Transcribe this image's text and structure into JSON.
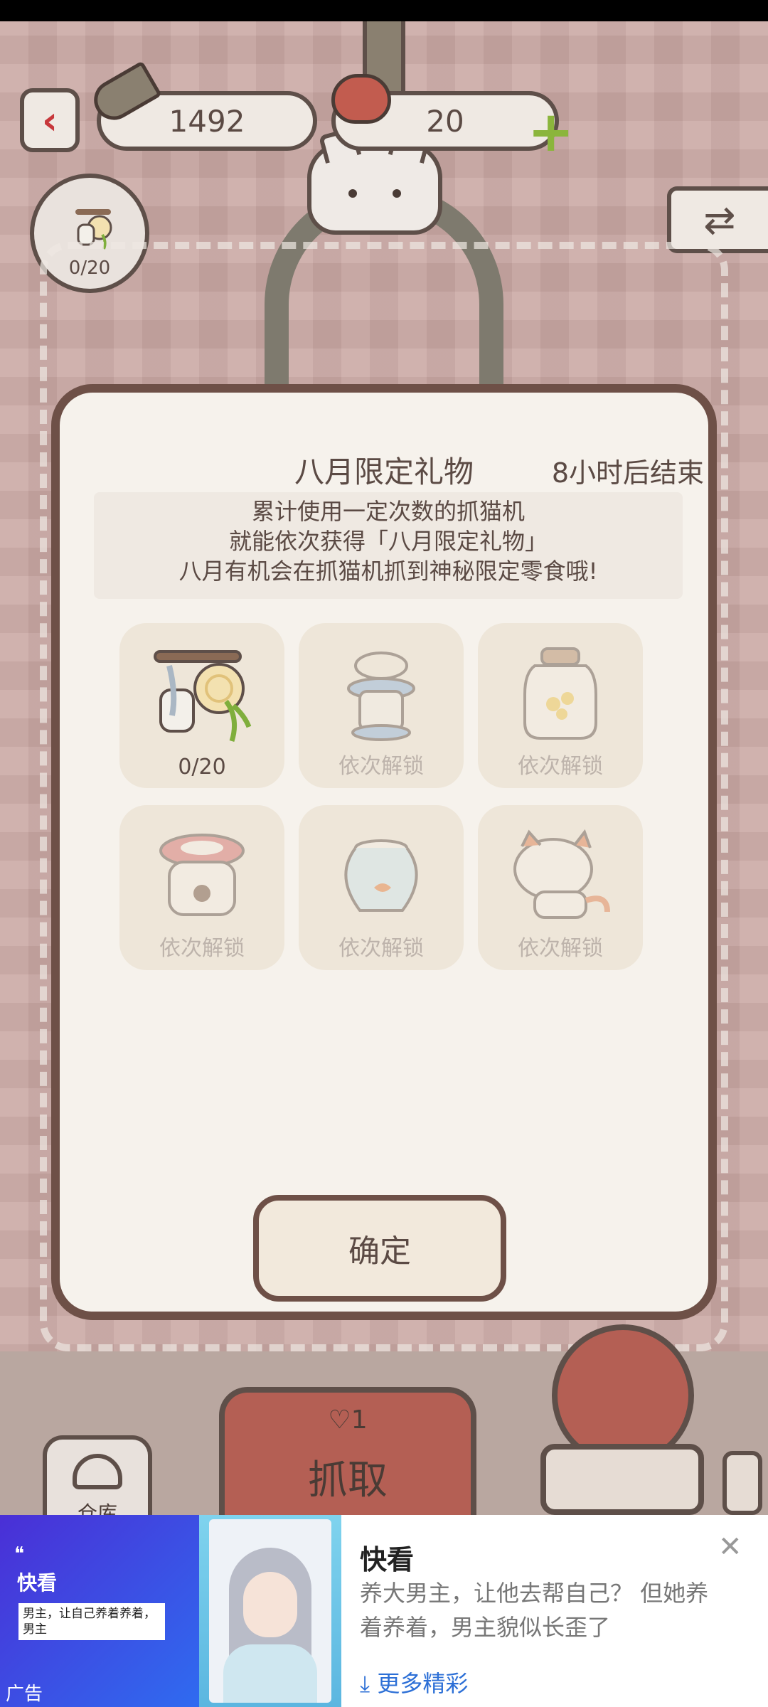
{
  "header": {
    "back_icon": "chevron-left-icon",
    "fish_count": "1492",
    "heart_count": "20",
    "collection_progress": "0/20"
  },
  "modal": {
    "title": "八月限定礼物",
    "timer": "8小时后结束",
    "description": [
      "累计使用一定次数的抓猫机",
      "就能依次获得「八月限定礼物」",
      "八月有机会在抓猫机抓到神秘限定零食哦!"
    ],
    "rewards": [
      {
        "icon": "mug-and-plate-icon",
        "label": "0/20",
        "locked": false
      },
      {
        "icon": "lantern-icon",
        "label": "依次解锁",
        "locked": true
      },
      {
        "icon": "candy-jar-icon",
        "label": "依次解锁",
        "locked": true
      },
      {
        "icon": "pot-icon",
        "label": "依次解锁",
        "locked": true
      },
      {
        "icon": "fishbowl-icon",
        "label": "依次解锁",
        "locked": true
      },
      {
        "icon": "calico-cat-icon",
        "label": "依次解锁",
        "locked": true
      }
    ],
    "confirm_label": "确定"
  },
  "bottom": {
    "grab_cost": "1",
    "grab_label": "抓取",
    "store_label": "仓库"
  },
  "ad": {
    "brand_left": "快看",
    "quote_mark": "❝",
    "note": "男主，让自己养着养着，男主",
    "ad_label": "广告",
    "title": "快看",
    "body": "养大男主，让他去帮自己？ 但她养着养着，男主貌似长歪了",
    "more": "更多精彩",
    "more_icon": "download-arrow-icon",
    "close_icon": "close-icon"
  },
  "colors": {
    "accent_red": "#c7373b",
    "modal_border": "#6e5047",
    "link_blue": "#2c6fd6",
    "plus_green": "#8bb53c"
  }
}
